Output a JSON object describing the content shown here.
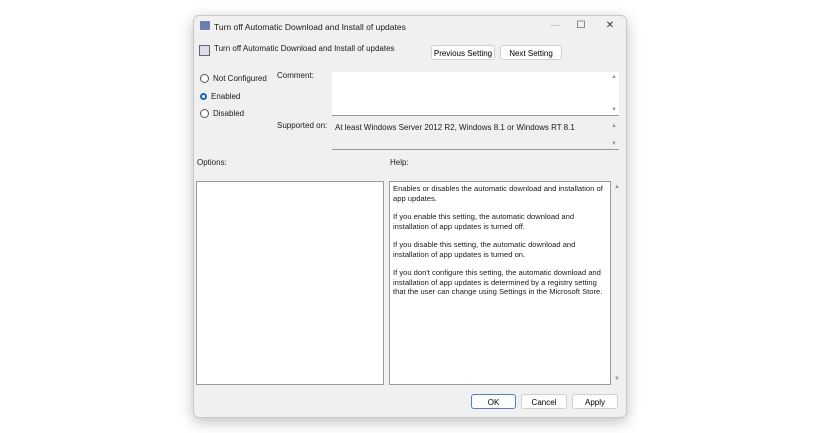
{
  "window": {
    "title": "Turn off Automatic Download and Install of updates",
    "minimize": "—",
    "maximize": "☐",
    "close": "✕"
  },
  "header": {
    "setting_name": "Turn off Automatic Download and Install of updates",
    "previous": "Previous Setting",
    "next": "Next Setting"
  },
  "state": {
    "options": [
      "Not Configured",
      "Enabled",
      "Disabled"
    ],
    "selected": "Enabled"
  },
  "comment": {
    "label": "Comment:",
    "value": ""
  },
  "supported": {
    "label": "Supported on:",
    "value": "At least Windows Server 2012 R2, Windows 8.1 or Windows RT 8.1"
  },
  "options_label": "Options:",
  "help_label": "Help:",
  "help": [
    "Enables or disables the automatic download and installation of app updates.",
    "If you enable this setting, the automatic download and installation of app updates is turned off.",
    "If you disable this setting, the automatic download and installation of app updates is turned on.",
    "If you don't configure this setting, the automatic download and installation of app updates is determined by a registry setting that the user can change using Settings in the Microsoft Store."
  ],
  "footer": {
    "ok": "OK",
    "cancel": "Cancel",
    "apply": "Apply"
  },
  "accent": "#1a5fb4"
}
